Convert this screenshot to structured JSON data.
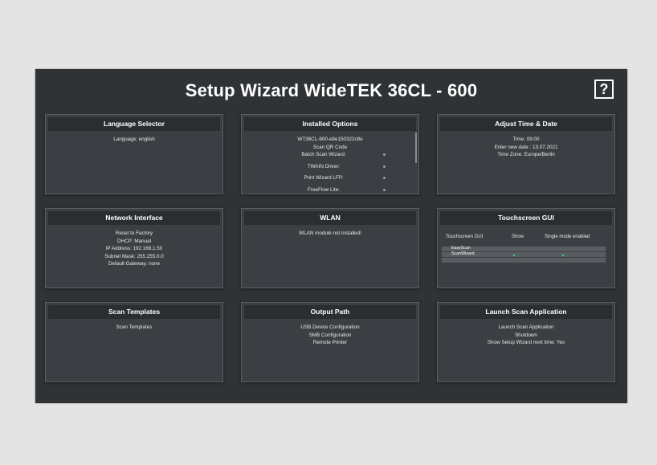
{
  "header": {
    "title": "Setup Wizard WideTEK 36CL - 600",
    "help_label": "?"
  },
  "panels": {
    "language": {
      "title": "Language Selector",
      "lines": [
        "Language: english"
      ]
    },
    "options": {
      "title": "Installed Options",
      "lines": [
        "WT36CL-600-e8e150322c8e",
        "Scan QR Code"
      ],
      "items": [
        "Batch Scan Wizard:",
        "TWAIN Driver:",
        "Print Wizard LFP:",
        "FreeFlow Lite:"
      ]
    },
    "time": {
      "title": "Adjust Time & Date",
      "lines": [
        "Time: 09:00",
        "Enter new date : 13.07.2021",
        "Time Zone: Europe/Berlin"
      ]
    },
    "network": {
      "title": "Network Interface",
      "lines": [
        "Reset to Factory",
        "DHCP: Manual",
        "IP Address: 192.168.1.50",
        "Subnet Mask: 255.255.0.0",
        "Default Gateway: none"
      ]
    },
    "wlan": {
      "title": "WLAN",
      "lines": [
        "WLAN module not installed!"
      ]
    },
    "touchscreen": {
      "title": "Touchscreen GUI",
      "columns": [
        "Touchscreen GUI",
        "Show",
        "Single mode enabled"
      ],
      "rows": [
        "EasyScan",
        "ScanWizard"
      ]
    },
    "templates": {
      "title": "Scan Templates",
      "lines": [
        "Scan Templates"
      ]
    },
    "output": {
      "title": "Output Path",
      "lines": [
        "USB Device Configuration",
        "SMB Configuration",
        "Remote Printer"
      ]
    },
    "launch": {
      "title": "Launch Scan Application",
      "lines": [
        "Launch Scan Application",
        "Shutdown",
        "Show Setup Wizard next time: Yes"
      ]
    }
  },
  "colors": {
    "screen_bg": "#2f3336",
    "panel_bg": "#3b3f43",
    "header_bg": "#2a2e31",
    "check_green": "#3ad36a"
  }
}
